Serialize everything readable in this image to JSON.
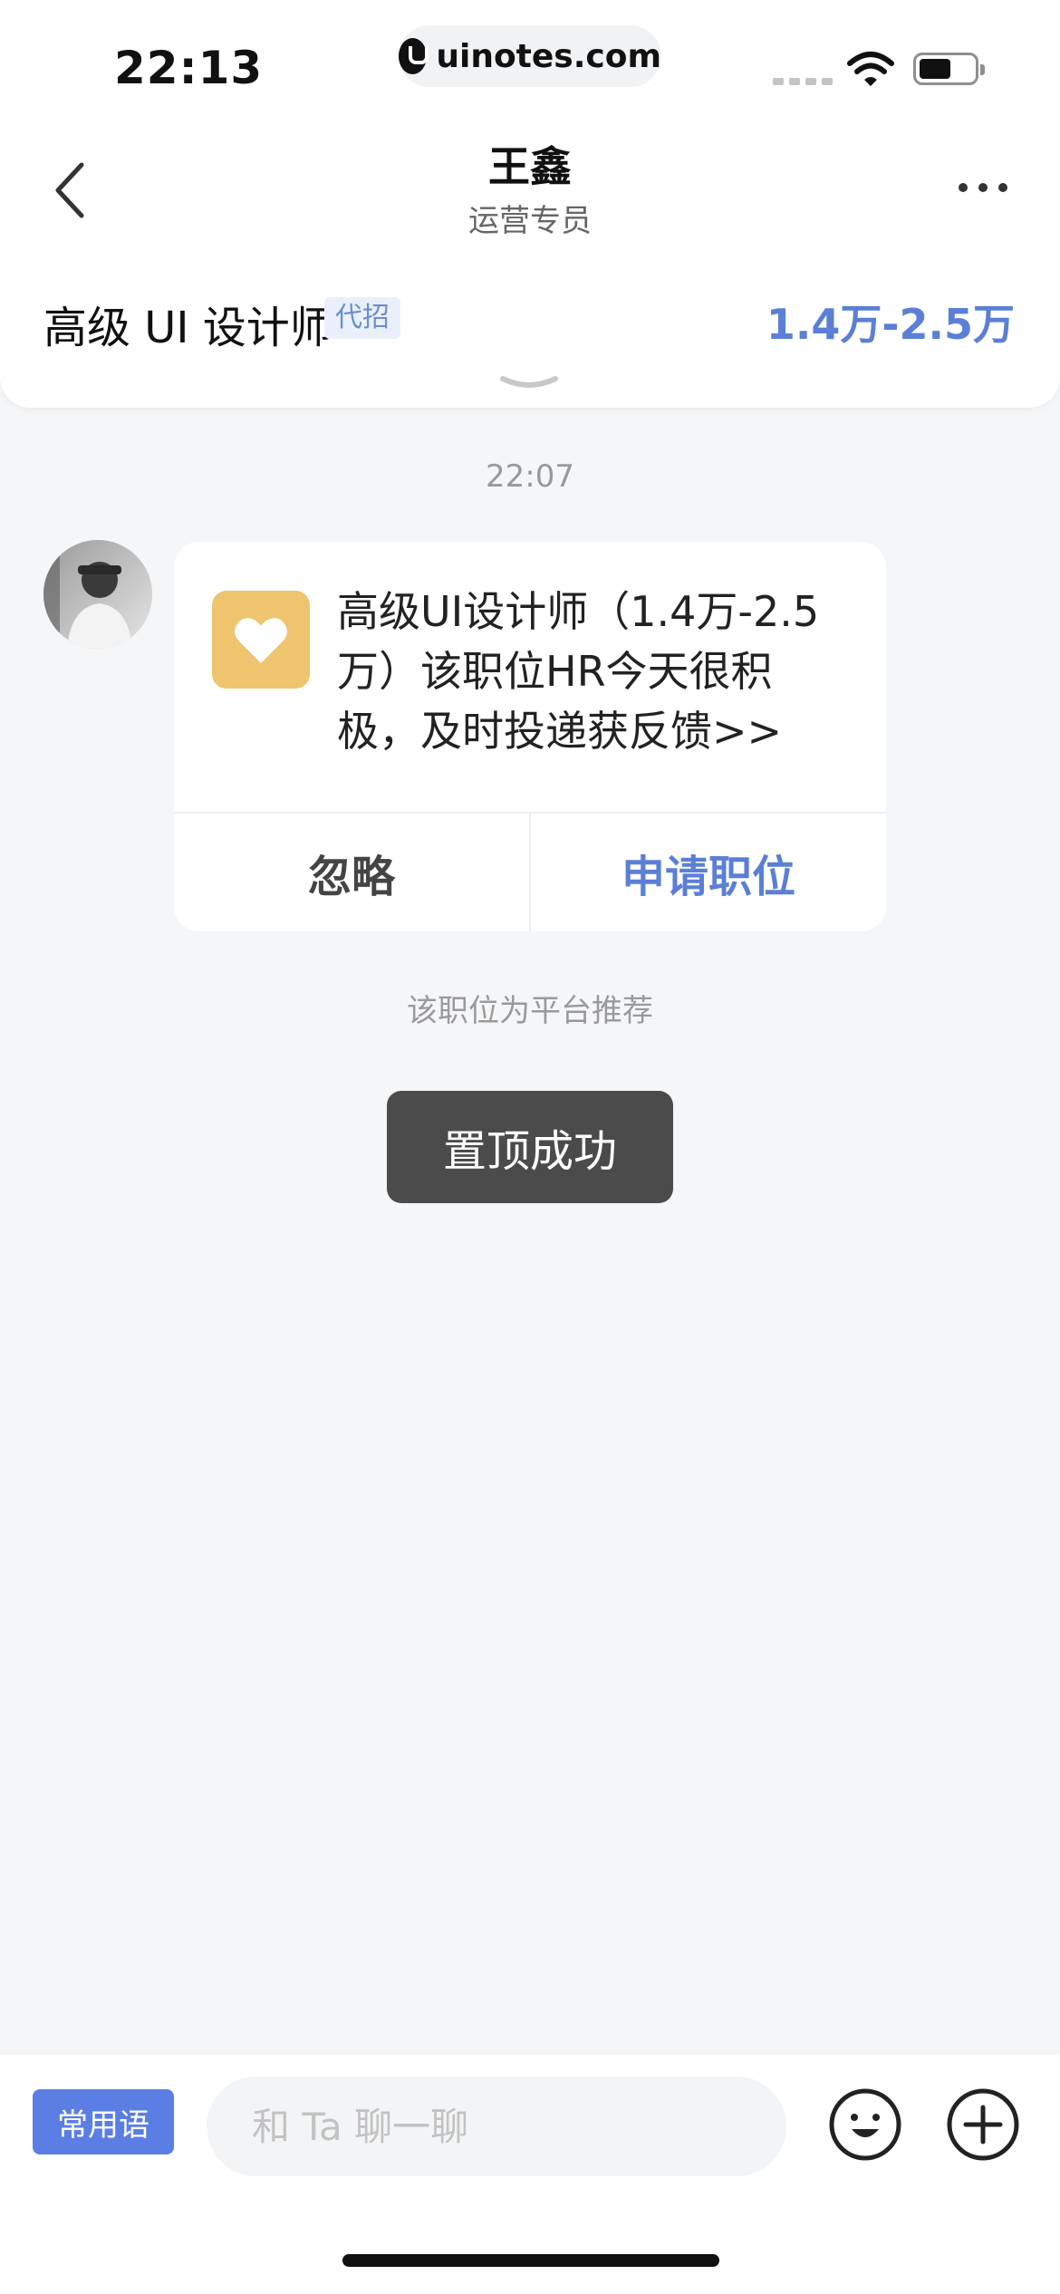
{
  "status_bar": {
    "time": "22:13",
    "url": "uinotes.com"
  },
  "header": {
    "name": "王鑫",
    "role": "运营专员",
    "job_title": "高级 UI 设计师",
    "job_tag": "代招",
    "salary": "1.4万-2.5万",
    "icons": [
      "back-arrow-icon",
      "more-icon",
      "chevron-down-icon"
    ]
  },
  "chat": {
    "timestamp": "22:07",
    "card": {
      "icon": "heart-icon",
      "text": "高级UI设计师（1.4万-2.5万）该职位HR今天很积极，及时投递获反馈>>",
      "ignore_label": "忽略",
      "apply_label": "申请职位"
    },
    "recommend_note": "该职位为平台推荐",
    "toast": "置顶成功"
  },
  "bottom_bar": {
    "phrases_label": "常用语",
    "input_placeholder": "和 Ta 聊一聊",
    "input_value": "",
    "icons": [
      "emoji-icon",
      "plus-icon"
    ]
  },
  "colors": {
    "accent": "#5b7fd6",
    "phrase_button": "#5b7ee4",
    "card_icon_bg": "#eec46f",
    "toast_bg": "#4b4b4b",
    "background": "#f5f6f8"
  }
}
